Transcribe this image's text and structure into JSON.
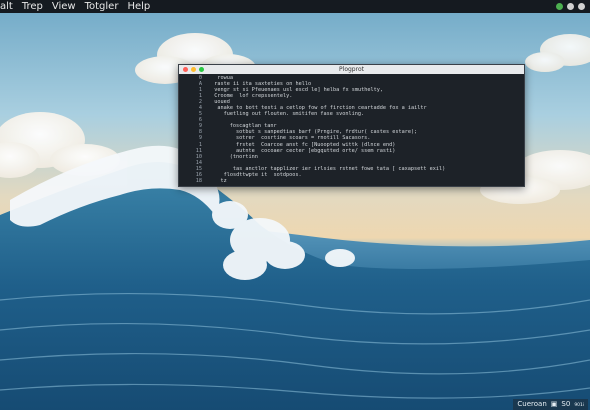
{
  "menubar": {
    "items": [
      "alt",
      "Trep",
      "View",
      "Totgler",
      "Help"
    ],
    "tray_colors": [
      "#4caf50",
      "#d0d0d0",
      "#d0d0d0"
    ]
  },
  "window": {
    "title": "Plogprot",
    "traffic_lights": [
      "#ff5f57",
      "#febc2e",
      "#28c840"
    ],
    "gutter": [
      "0",
      "A",
      "1",
      "1",
      "2",
      "4",
      "5",
      "6",
      "9",
      "8",
      "9",
      "1",
      "11",
      "10",
      "14",
      "15",
      "16",
      "18"
    ],
    "lines": [
      {
        "indent": 4,
        "text": "rowua",
        "kw": false
      },
      {
        "indent": 3,
        "text": "raste ii ita saxteties on hello",
        "kw": false
      },
      {
        "indent": 3,
        "text": "vengr st si Pfeuenaes usl escd le] helba fx smuthelty,",
        "kw": false
      },
      {
        "indent": 3,
        "text": "Croome  lof crepssentely.",
        "kw": false
      },
      {
        "indent": 3,
        "text": "uoued",
        "kw": false
      },
      {
        "indent": 4,
        "text": "anake to bott testi a cetlop fow of firction ceartadde fox a iailtr",
        "kw": false
      },
      {
        "indent": 6,
        "text": "fuetling out flouten. smitifen fase svonling.",
        "kw": false
      },
      {
        "indent": 0,
        "text": "",
        "kw": false
      },
      {
        "indent": 8,
        "text": "foscagtlan tanr",
        "kw": true
      },
      {
        "indent": 8,
        "text": "  sotbut s sanpedtias barf (Prngire, frdtur( castes estare);",
        "kw": true
      },
      {
        "indent": 8,
        "text": "  sotrer  cosrtine scoars = rnotill Sacasors.",
        "kw": true
      },
      {
        "indent": 8,
        "text": "  frstet  Coarcoe anst fc [Nuoopted wittk (dlnce end)",
        "kw": true
      },
      {
        "indent": 8,
        "text": "  autnte  cocoaer cecter [ebgqutted orte/ ssem rasti)",
        "kw": true
      },
      {
        "indent": 8,
        "text": "(tnortinn",
        "kw": true
      },
      {
        "indent": 0,
        "text": "",
        "kw": false
      },
      {
        "indent": 9,
        "text": "tas anctlor tapplizer ier irlsies rstnet fowe tata [ caxapsett exil)",
        "kw": false
      },
      {
        "indent": 6,
        "text": "flosdttwpte it  sotdpoos.",
        "kw": false
      },
      {
        "indent": 5,
        "text": "tz",
        "kw": false
      }
    ]
  },
  "status": {
    "items": [
      "Cueroan",
      "▣",
      "S0",
      "₉₀₁ᵢ"
    ]
  }
}
